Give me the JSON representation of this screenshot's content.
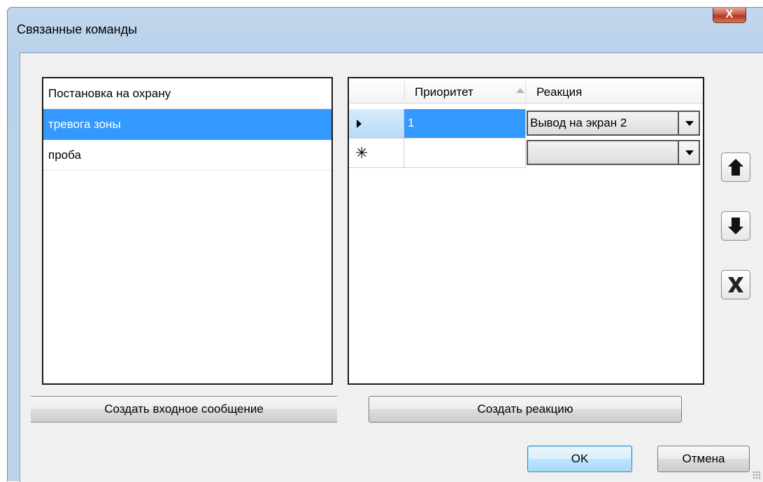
{
  "window": {
    "title": "Связанные команды",
    "close_glyph": "X"
  },
  "messages_list": {
    "items": [
      {
        "label": "Постановка на охрану",
        "selected": false
      },
      {
        "label": "тревога зоны",
        "selected": true
      },
      {
        "label": "проба",
        "selected": false
      }
    ]
  },
  "reactions_grid": {
    "columns": [
      "Приоритет",
      "Реакция"
    ],
    "sort": {
      "column": "Приоритет",
      "direction": "ascending"
    },
    "rows": [
      {
        "priority": "1",
        "reaction": "Вывод на экран 2",
        "current": true
      },
      {
        "priority": "",
        "reaction": "",
        "new_row": true
      }
    ]
  },
  "side_buttons": {
    "up_icon": "arrow-up-icon",
    "down_icon": "arrow-down-icon",
    "delete_icon": "delete-x-icon"
  },
  "buttons": {
    "create_input_message": "Создать входное сообщение",
    "create_reaction": "Создать реакцию",
    "ok": "OK",
    "cancel": "Отмена"
  },
  "colors": {
    "selection": "#3399ff",
    "title_bar": "#b9d1ea",
    "close_button": "#c75a44"
  }
}
